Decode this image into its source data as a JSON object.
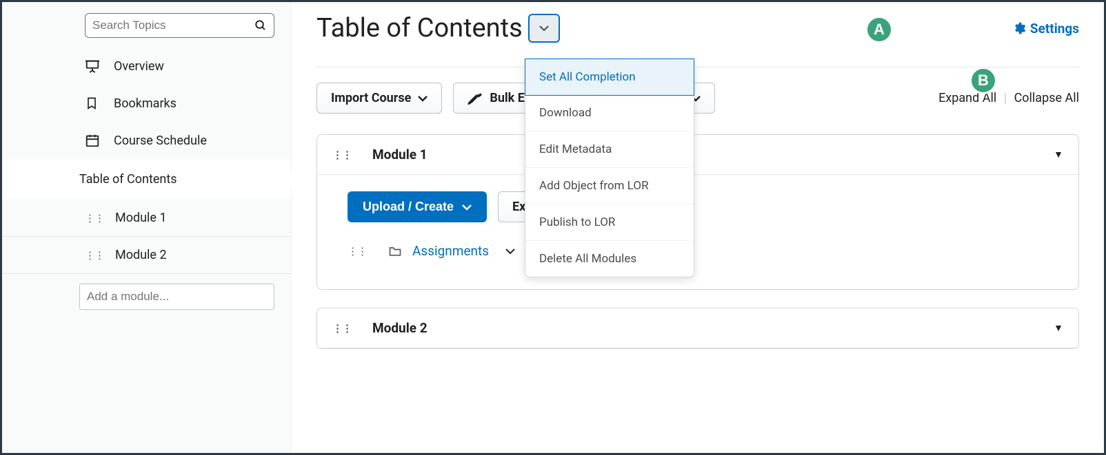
{
  "sidebar": {
    "search_placeholder": "Search Topics",
    "overview": "Overview",
    "bookmarks": "Bookmarks",
    "course_schedule": "Course Schedule",
    "toc": "Table of Contents",
    "modules": [
      "Module 1",
      "Module 2"
    ],
    "add_module_placeholder": "Add a module..."
  },
  "header": {
    "title": "Table of Contents",
    "settings": "Settings"
  },
  "toolbar": {
    "import_course": "Import Course",
    "bulk_edit": "Bulk Edit",
    "expand_all": "Expand All",
    "collapse_all": "Collapse All"
  },
  "menu": {
    "set_completion": "Set All Completion",
    "download": "Download",
    "edit_metadata": "Edit Metadata",
    "add_lor": "Add Object from LOR",
    "publish_lor": "Publish to LOR",
    "delete_all": "Delete All Modules"
  },
  "module1": {
    "title": "Module 1",
    "upload_create": "Upload / Create",
    "existing": "Existing Activities",
    "topic_assignments": "Assignments"
  },
  "module2": {
    "title": "Module 2"
  },
  "annotations": {
    "a": "A",
    "b": "B"
  }
}
